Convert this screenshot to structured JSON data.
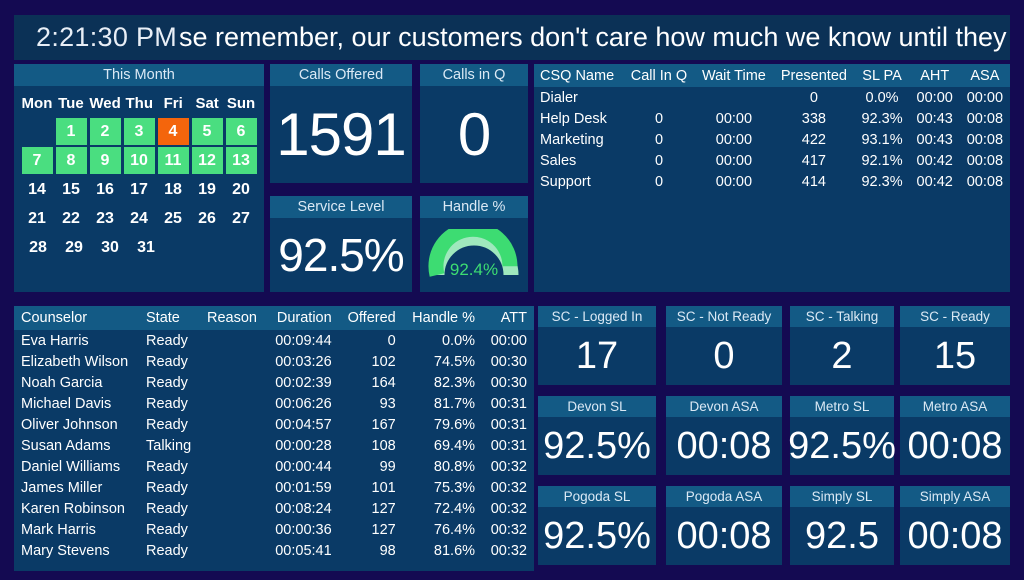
{
  "ticker": {
    "clock": "2:21:30 PM",
    "message": "se remember, our customers don't care how much we know until they know how"
  },
  "calendar": {
    "title": "This Month",
    "dow": [
      "Mon",
      "Tue",
      "Wed",
      "Thu",
      "Fri",
      "Sat",
      "Sun"
    ],
    "lead_blanks": 1,
    "days": [
      {
        "n": "1",
        "state": "green"
      },
      {
        "n": "2",
        "state": "green"
      },
      {
        "n": "3",
        "state": "green"
      },
      {
        "n": "4",
        "state": "orange"
      },
      {
        "n": "5",
        "state": "green"
      },
      {
        "n": "6",
        "state": "green"
      },
      {
        "n": "7",
        "state": "green"
      },
      {
        "n": "8",
        "state": "green"
      },
      {
        "n": "9",
        "state": "green"
      },
      {
        "n": "10",
        "state": "green"
      },
      {
        "n": "11",
        "state": "green"
      },
      {
        "n": "12",
        "state": "green"
      },
      {
        "n": "13",
        "state": "green"
      },
      {
        "n": "14",
        "state": "plain"
      },
      {
        "n": "15",
        "state": "plain"
      },
      {
        "n": "16",
        "state": "plain"
      },
      {
        "n": "17",
        "state": "plain"
      },
      {
        "n": "18",
        "state": "plain"
      },
      {
        "n": "19",
        "state": "plain"
      },
      {
        "n": "20",
        "state": "plain"
      },
      {
        "n": "21",
        "state": "plain"
      },
      {
        "n": "22",
        "state": "plain"
      },
      {
        "n": "23",
        "state": "plain"
      },
      {
        "n": "24",
        "state": "plain"
      },
      {
        "n": "25",
        "state": "plain"
      },
      {
        "n": "26",
        "state": "plain"
      },
      {
        "n": "27",
        "state": "plain"
      },
      {
        "n": "28",
        "state": "plain"
      },
      {
        "n": "29",
        "state": "plain"
      },
      {
        "n": "30",
        "state": "plain"
      },
      {
        "n": "31",
        "state": "plain"
      }
    ]
  },
  "kpis": {
    "calls_offered": {
      "label": "Calls Offered",
      "value": "1591"
    },
    "calls_in_q": {
      "label": "Calls in Q",
      "value": "0"
    },
    "service_level": {
      "label": "Service Level",
      "value": "92.5%"
    },
    "handle_pct": {
      "label": "Handle %",
      "value": "92.4%",
      "percent": 92.4
    }
  },
  "csq": {
    "columns": [
      "CSQ Name",
      "Call In Q",
      "Wait Time",
      "Presented",
      "SL PA",
      "AHT",
      "ASA"
    ],
    "rows": [
      {
        "name": "Dialer",
        "call_in_q": "",
        "wait": "",
        "presented": "0",
        "sl_pa": "0.0%",
        "sl_warn": true,
        "aht": "00:00",
        "asa": "00:00"
      },
      {
        "name": "Help Desk",
        "call_in_q": "0",
        "wait": "00:00",
        "presented": "338",
        "sl_pa": "92.3%",
        "sl_warn": false,
        "aht": "00:43",
        "asa": "00:08"
      },
      {
        "name": "Marketing",
        "call_in_q": "0",
        "wait": "00:00",
        "presented": "422",
        "sl_pa": "93.1%",
        "sl_warn": false,
        "aht": "00:43",
        "asa": "00:08"
      },
      {
        "name": "Sales",
        "call_in_q": "0",
        "wait": "00:00",
        "presented": "417",
        "sl_pa": "92.1%",
        "sl_warn": false,
        "aht": "00:42",
        "asa": "00:08"
      },
      {
        "name": "Support",
        "call_in_q": "0",
        "wait": "00:00",
        "presented": "414",
        "sl_pa": "92.3%",
        "sl_warn": false,
        "aht": "00:42",
        "asa": "00:08"
      }
    ]
  },
  "counselors": {
    "columns": [
      "Counselor",
      "State",
      "Reason",
      "Duration",
      "Offered",
      "Handle %",
      "ATT"
    ],
    "rows": [
      {
        "name": "Eva Harris",
        "state": "Ready",
        "reason": "",
        "duration": "00:09:44",
        "offered": "0",
        "handle": "0.0%",
        "att": "00:00"
      },
      {
        "name": "Elizabeth Wilson",
        "state": "Ready",
        "reason": "",
        "duration": "00:03:26",
        "offered": "102",
        "handle": "74.5%",
        "att": "00:30"
      },
      {
        "name": "Noah Garcia",
        "state": "Ready",
        "reason": "",
        "duration": "00:02:39",
        "offered": "164",
        "handle": "82.3%",
        "att": "00:30"
      },
      {
        "name": "Michael Davis",
        "state": "Ready",
        "reason": "",
        "duration": "00:06:26",
        "offered": "93",
        "handle": "81.7%",
        "att": "00:31"
      },
      {
        "name": "Oliver Johnson",
        "state": "Ready",
        "reason": "",
        "duration": "00:04:57",
        "offered": "167",
        "handle": "79.6%",
        "att": "00:31"
      },
      {
        "name": "Susan Adams",
        "state": "Talking",
        "reason": "",
        "duration": "00:00:28",
        "offered": "108",
        "handle": "69.4%",
        "att": "00:31"
      },
      {
        "name": "Daniel Williams",
        "state": "Ready",
        "reason": "",
        "duration": "00:00:44",
        "offered": "99",
        "handle": "80.8%",
        "att": "00:32"
      },
      {
        "name": "James Miller",
        "state": "Ready",
        "reason": "",
        "duration": "00:01:59",
        "offered": "101",
        "handle": "75.3%",
        "att": "00:32"
      },
      {
        "name": "Karen Robinson",
        "state": "Ready",
        "reason": "",
        "duration": "00:08:24",
        "offered": "127",
        "handle": "72.4%",
        "att": "00:32"
      },
      {
        "name": "Mark Harris",
        "state": "Ready",
        "reason": "",
        "duration": "00:00:36",
        "offered": "127",
        "handle": "76.4%",
        "att": "00:32"
      },
      {
        "name": "Mary Stevens",
        "state": "Ready",
        "reason": "",
        "duration": "00:05:41",
        "offered": "98",
        "handle": "81.6%",
        "att": "00:32"
      }
    ]
  },
  "stat_tiles": [
    {
      "label": "SC - Logged In",
      "value": "17"
    },
    {
      "label": "SC - Not Ready",
      "value": "0"
    },
    {
      "label": "SC - Talking",
      "value": "2"
    },
    {
      "label": "SC - Ready",
      "value": "15"
    },
    {
      "label": "Devon SL",
      "value": "92.5%"
    },
    {
      "label": "Devon ASA",
      "value": "00:08"
    },
    {
      "label": "Metro SL",
      "value": "92.5%"
    },
    {
      "label": "Metro ASA",
      "value": "00:08"
    },
    {
      "label": "Pogoda SL",
      "value": "92.5%"
    },
    {
      "label": "Pogoda ASA",
      "value": "00:08"
    },
    {
      "label": "Simply SL",
      "value": "92.5"
    },
    {
      "label": "Simply ASA",
      "value": "00:08"
    }
  ],
  "colors": {
    "background": "#140a52",
    "panel": "#0a3a66",
    "panel_header": "#135a85",
    "ticker": "#0b3156",
    "green": "#4ade80",
    "gauge_green": "#3ddc72",
    "gauge_track": "#9fe8bd",
    "orange": "#f4650c",
    "warn_text": "#e8601c"
  }
}
